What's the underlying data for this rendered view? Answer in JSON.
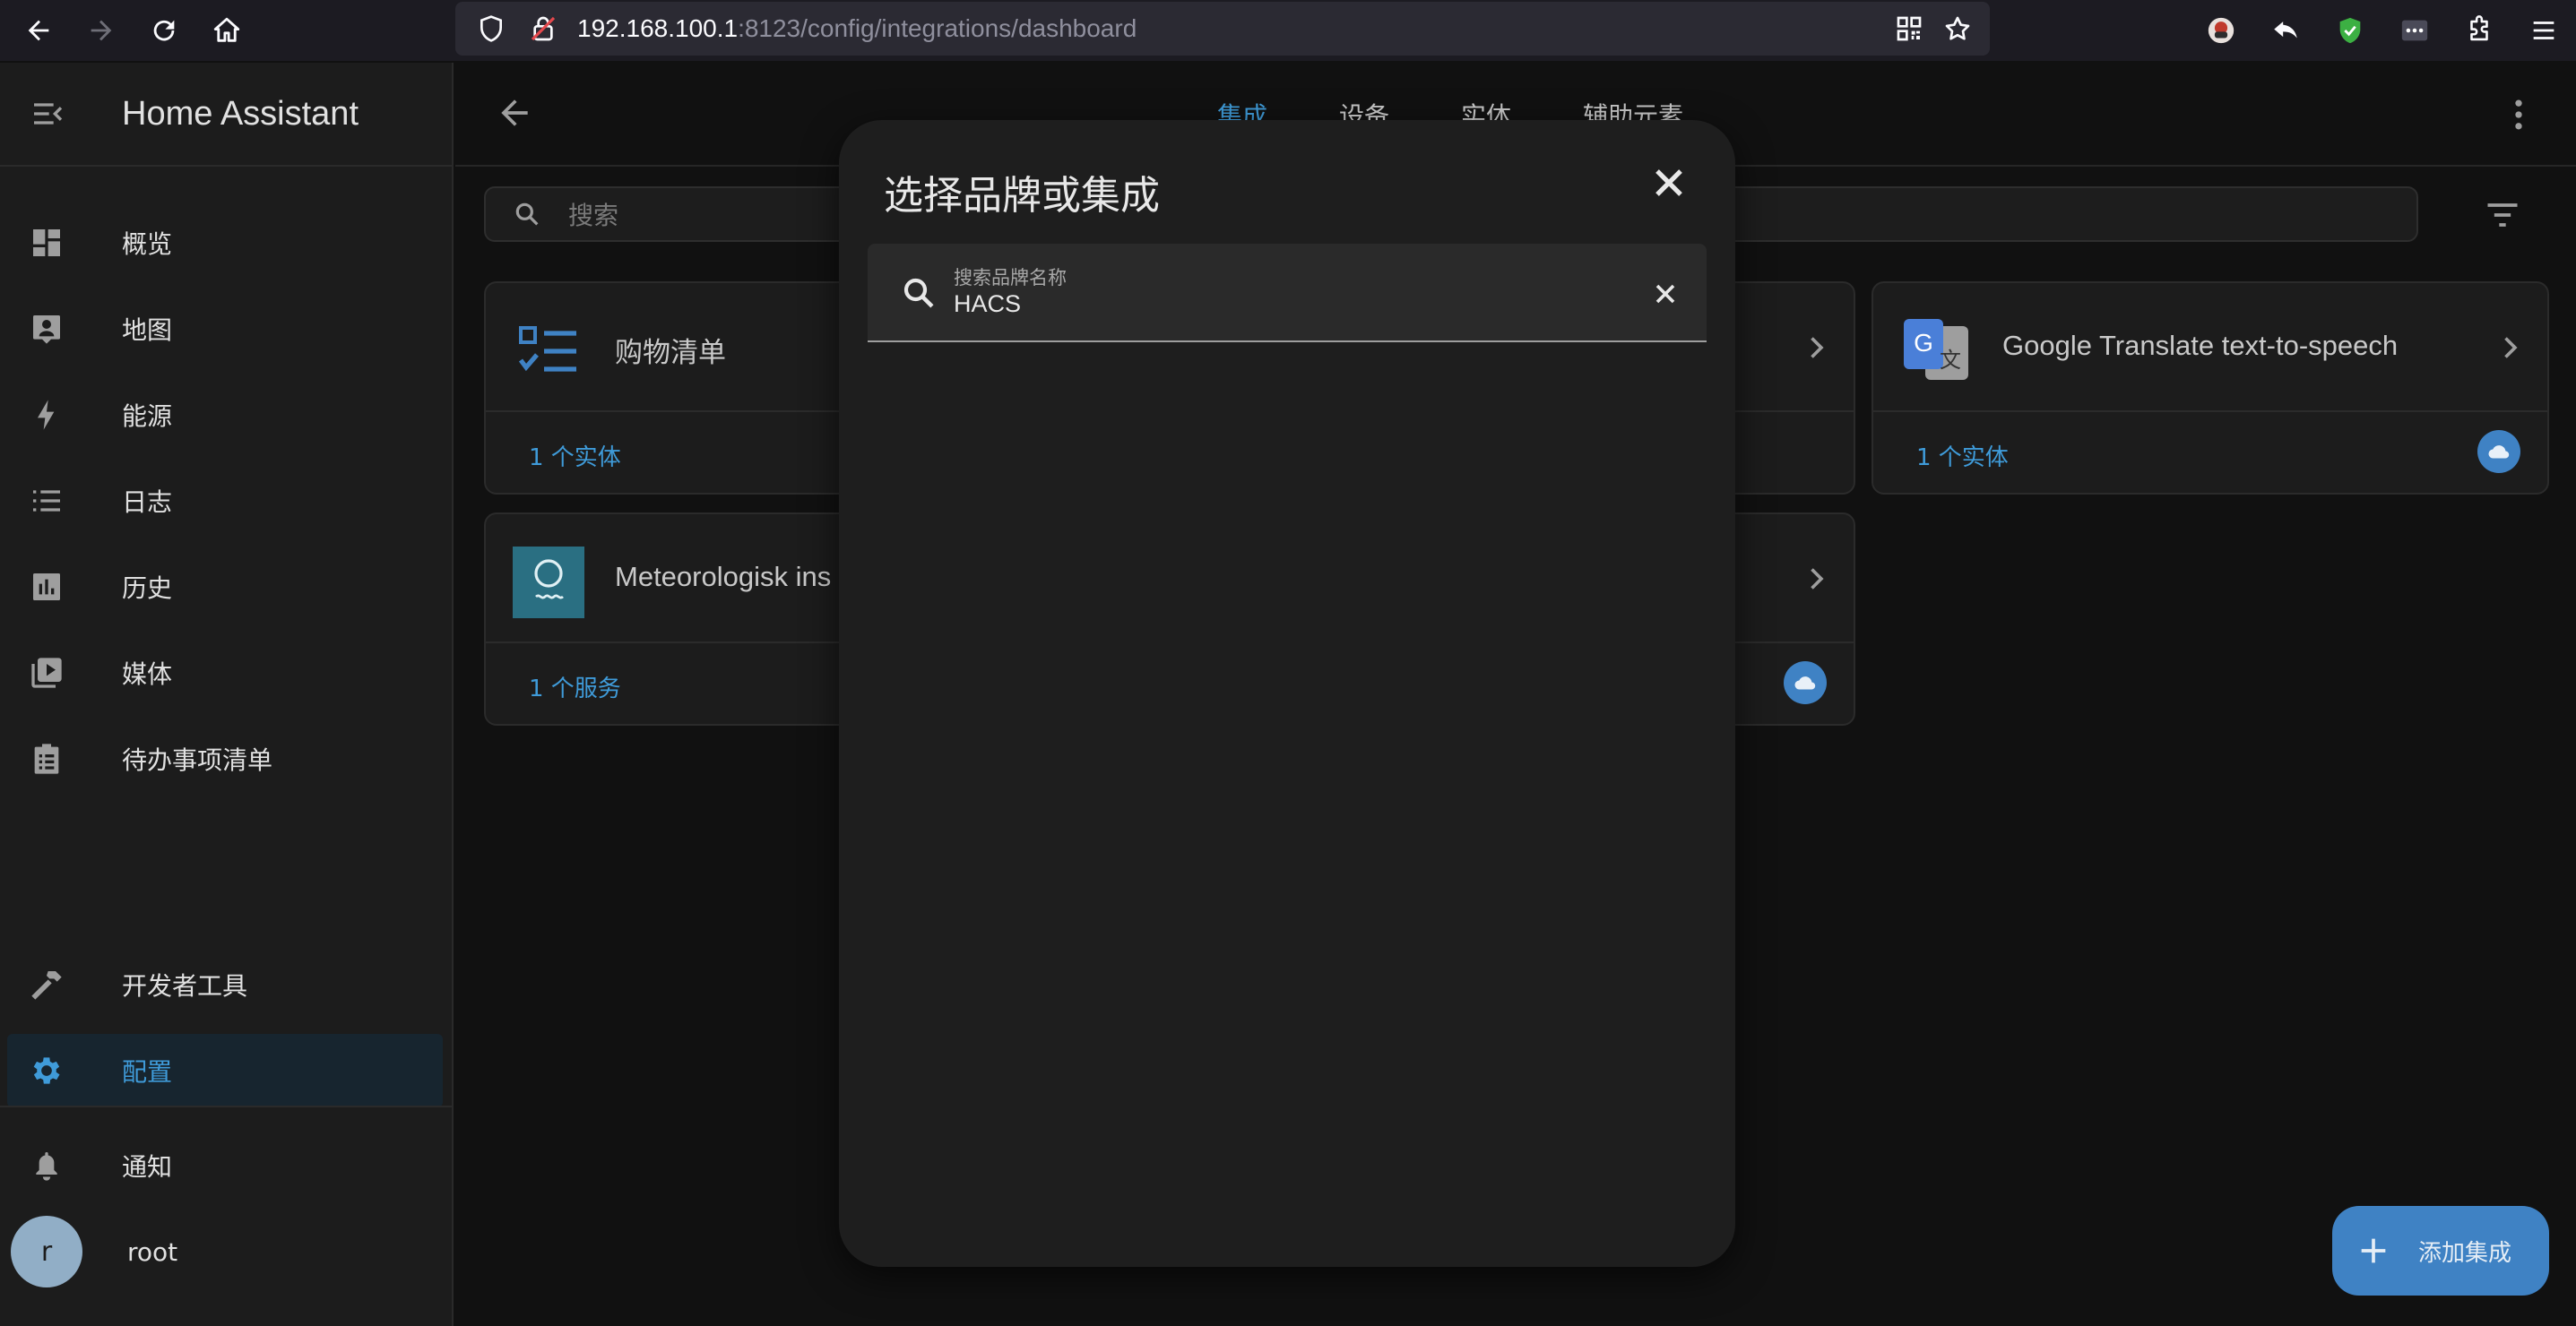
{
  "browser": {
    "url_host": "192.168.100.1",
    "url_rest": ":8123/config/integrations/dashboard"
  },
  "sidebar": {
    "title": "Home Assistant",
    "items": [
      {
        "label": "概览",
        "icon": "dashboard-icon"
      },
      {
        "label": "地图",
        "icon": "map-account-icon"
      },
      {
        "label": "能源",
        "icon": "lightning-icon"
      },
      {
        "label": "日志",
        "icon": "list-icon"
      },
      {
        "label": "历史",
        "icon": "chart-box-icon"
      },
      {
        "label": "媒体",
        "icon": "play-box-multiple-icon"
      },
      {
        "label": "待办事项清单",
        "icon": "clipboard-list-icon"
      }
    ],
    "dev_tools": "开发者工具",
    "config": "配置",
    "notifications": "通知",
    "user": {
      "initial": "r",
      "name": "root"
    }
  },
  "header": {
    "tabs": [
      "集成",
      "设备",
      "实体",
      "辅助元素"
    ],
    "active_tab": 0
  },
  "search": {
    "placeholder": "搜索"
  },
  "cards": [
    {
      "name": "购物清单",
      "footer": "1 个实体"
    },
    {
      "name": "Google Translate text-to-speech",
      "footer": "1 个实体"
    },
    {
      "name": "Meteorologisk ins",
      "footer": "1 个服务"
    }
  ],
  "dialog": {
    "title": "选择品牌或集成",
    "field_label": "搜索品牌名称",
    "field_value": "HACS"
  },
  "fab": {
    "label": "添加集成"
  },
  "colors": {
    "accent": "#3f9bd9",
    "background": "#111111",
    "card": "#1c1c1c",
    "dialog": "#1e1e1e"
  }
}
